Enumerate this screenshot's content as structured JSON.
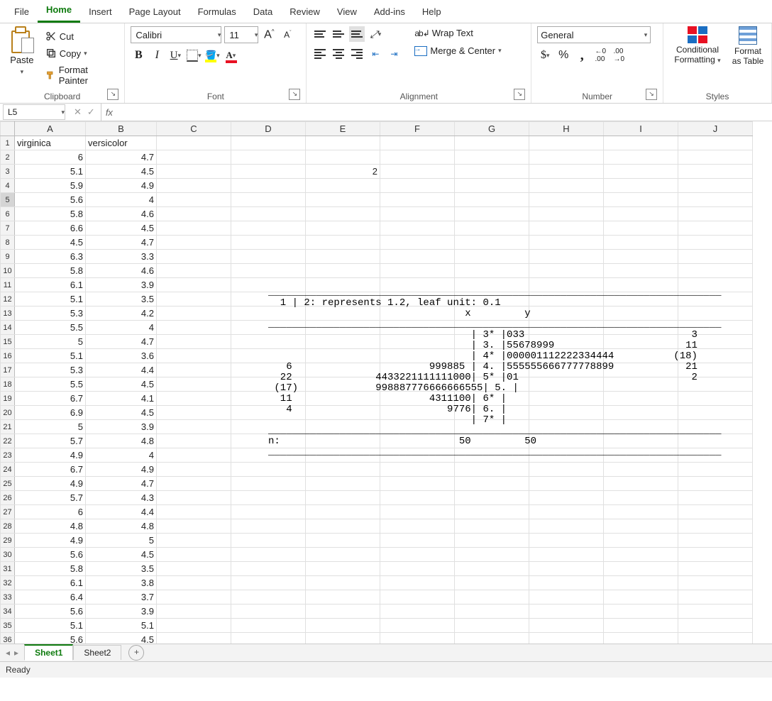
{
  "tabs": {
    "file": "File",
    "home": "Home",
    "insert": "Insert",
    "pagelayout": "Page Layout",
    "formulas": "Formulas",
    "data": "Data",
    "review": "Review",
    "view": "View",
    "addins": "Add-ins",
    "help": "Help"
  },
  "clipboard": {
    "paste": "Paste",
    "cut": "Cut",
    "copy": "Copy",
    "painter": "Format Painter",
    "label": "Clipboard"
  },
  "font": {
    "name": "Calibri",
    "size": "11",
    "grow_tip": "A",
    "shrink_tip": "A",
    "label": "Font"
  },
  "alignment": {
    "wrap": "Wrap Text",
    "merge": "Merge & Center",
    "label": "Alignment"
  },
  "number": {
    "format": "General",
    "label": "Number"
  },
  "styles": {
    "cond": "Conditional Formatting",
    "table": "Format as Table",
    "label": "Styles"
  },
  "namebox": "L5",
  "columns": [
    "A",
    "B",
    "C",
    "D",
    "E",
    "F",
    "G",
    "H",
    "I",
    "J"
  ],
  "rows": [
    {
      "n": "1",
      "a": "virginica",
      "b": "versicolor",
      "at": "txt",
      "bt": "txt"
    },
    {
      "n": "2",
      "a": "6",
      "b": "4.7"
    },
    {
      "n": "3",
      "a": "5.1",
      "b": "4.5",
      "e": "2"
    },
    {
      "n": "4",
      "a": "5.9",
      "b": "4.9"
    },
    {
      "n": "5",
      "a": "5.6",
      "b": "4"
    },
    {
      "n": "6",
      "a": "5.8",
      "b": "4.6"
    },
    {
      "n": "7",
      "a": "6.6",
      "b": "4.5"
    },
    {
      "n": "8",
      "a": "4.5",
      "b": "4.7"
    },
    {
      "n": "9",
      "a": "6.3",
      "b": "3.3"
    },
    {
      "n": "10",
      "a": "5.8",
      "b": "4.6"
    },
    {
      "n": "11",
      "a": "6.1",
      "b": "3.9"
    },
    {
      "n": "12",
      "a": "5.1",
      "b": "3.5"
    },
    {
      "n": "13",
      "a": "5.3",
      "b": "4.2"
    },
    {
      "n": "14",
      "a": "5.5",
      "b": "4"
    },
    {
      "n": "15",
      "a": "5",
      "b": "4.7"
    },
    {
      "n": "16",
      "a": "5.1",
      "b": "3.6"
    },
    {
      "n": "17",
      "a": "5.3",
      "b": "4.4"
    },
    {
      "n": "18",
      "a": "5.5",
      "b": "4.5"
    },
    {
      "n": "19",
      "a": "6.7",
      "b": "4.1"
    },
    {
      "n": "20",
      "a": "6.9",
      "b": "4.5"
    },
    {
      "n": "21",
      "a": "5",
      "b": "3.9"
    },
    {
      "n": "22",
      "a": "5.7",
      "b": "4.8"
    },
    {
      "n": "23",
      "a": "4.9",
      "b": "4"
    },
    {
      "n": "24",
      "a": "6.7",
      "b": "4.9"
    },
    {
      "n": "25",
      "a": "4.9",
      "b": "4.7"
    },
    {
      "n": "26",
      "a": "5.7",
      "b": "4.3"
    },
    {
      "n": "27",
      "a": "6",
      "b": "4.4"
    },
    {
      "n": "28",
      "a": "4.8",
      "b": "4.8"
    },
    {
      "n": "29",
      "a": "4.9",
      "b": "5"
    },
    {
      "n": "30",
      "a": "5.6",
      "b": "4.5"
    },
    {
      "n": "31",
      "a": "5.8",
      "b": "3.5"
    },
    {
      "n": "32",
      "a": "6.1",
      "b": "3.8"
    },
    {
      "n": "33",
      "a": "6.4",
      "b": "3.7"
    },
    {
      "n": "34",
      "a": "5.6",
      "b": "3.9"
    },
    {
      "n": "35",
      "a": "5.1",
      "b": "5.1"
    },
    {
      "n": "36",
      "a": "5.6",
      "b": "4.5"
    }
  ],
  "stemplot": "____________________________________________________________________________\n  1 | 2: represents 1.2, leaf unit: 0.1\n                                 x         y\n____________________________________________________________________________\n                                  | 3* |033                            3\n                                  | 3. |55678999                      11\n                                  | 4* |000001112222334444          (18)\n   6                       999885 | 4. |555555666777778899            21\n  22              4433221111111000| 5* |01                             2\n (17)             998887776666666555| 5. |\n  11                       4311100| 6* |\n   4                          9776| 6. |\n                                  | 7* |\n____________________________________________________________________________\nn:                              50         50\n____________________________________________________________________________",
  "sheets": {
    "s1": "Sheet1",
    "s2": "Sheet2"
  },
  "status": "Ready"
}
